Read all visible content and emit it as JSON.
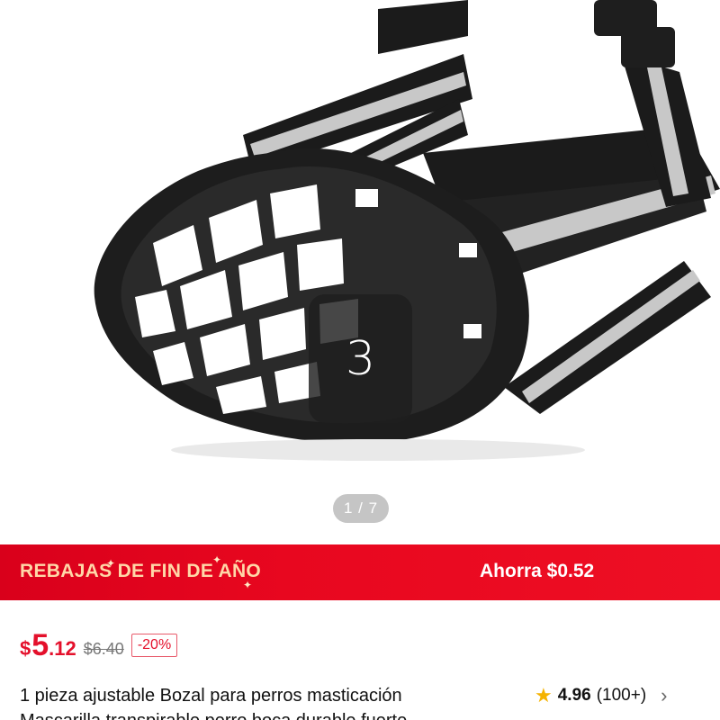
{
  "gallery": {
    "badge_number": "3",
    "pager": "1 / 7"
  },
  "promo": {
    "title": "REBAJAS DE FIN DE AÑO",
    "savings": "Ahorra $0.52"
  },
  "price": {
    "currency": "$",
    "integer": "5",
    "decimal": ".12",
    "original": "$6.40",
    "discount": "-20%"
  },
  "product": {
    "title_line1": "1 pieza ajustable Bozal para perros masticación",
    "title_line2": "Mascarilla transpirable perro boca durable fuerte"
  },
  "rating": {
    "score": "4.96",
    "count": "(100+)"
  },
  "colors": {
    "promo_red": "#e8071f",
    "price_red": "#e4102b",
    "star": "#f5b301"
  }
}
